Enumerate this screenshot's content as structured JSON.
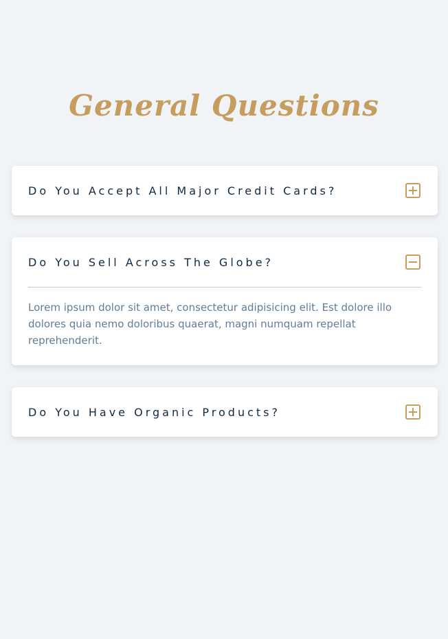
{
  "title": "General Questions",
  "colors": {
    "accent": "#c59d5f",
    "question_text": "#102a42",
    "answer_text": "#617d98",
    "background": "#f1f4f7"
  },
  "faq": [
    {
      "question": "Do You Accept All Major Credit Cards?",
      "expanded": false,
      "toggle_icon": "plus-icon"
    },
    {
      "question": "Do You Sell Across The Globe?",
      "expanded": true,
      "toggle_icon": "minus-icon",
      "answer": "Lorem ipsum dolor sit amet, consectetur adipisicing elit. Est dolore illo dolores quia nemo doloribus quaerat, magni numquam repellat reprehenderit."
    },
    {
      "question": "Do You Have Organic Products?",
      "expanded": false,
      "toggle_icon": "plus-icon"
    }
  ]
}
